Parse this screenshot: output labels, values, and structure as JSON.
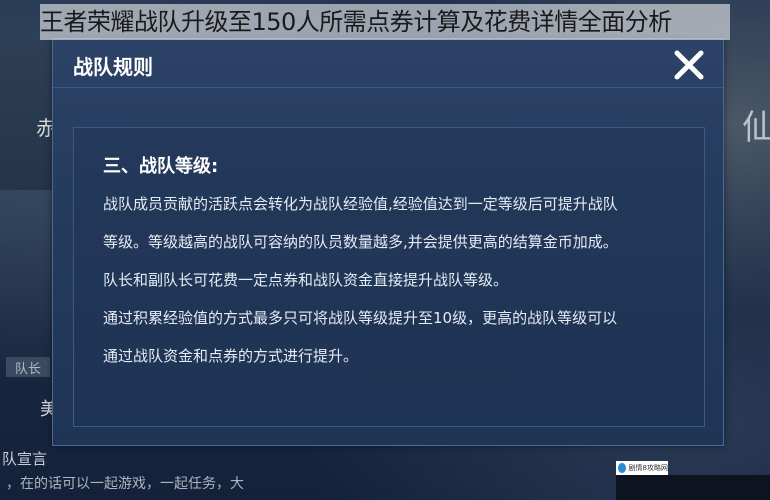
{
  "headline": "王者荣耀战队升级至150人所需点券计算及花费详情全面分析",
  "background": {
    "tag_label": "队长",
    "bottom_line1": "队宣言",
    "bottom_line2": "，在的话可以一起游戏，一起任务，大",
    "left_char_1": "赤",
    "left_char_2": "美",
    "right_char": "仙"
  },
  "dialog": {
    "title": "战队规则",
    "section_heading": "三、战队等级:",
    "paragraphs": [
      "战队成员贡献的活跃点会转化为战队经验值,经验值达到一定等级后可提升战队",
      "等级。等级越高的战队可容纳的队员数量越多,并会提供更高的结算金币加成。",
      "队长和副队长可花费一定点券和战队资金直接提升战队等级。",
      "通过积累经验值的方式最多只可将战队等级提升至10级，更高的战队等级可以",
      "通过战队资金和点券的方式进行提升。"
    ]
  },
  "watermark": {
    "text": "剧情8攻略网"
  },
  "colors": {
    "dialog_bg": "#243a5c",
    "text": "#e6ebf3",
    "title": "#ffffff"
  }
}
